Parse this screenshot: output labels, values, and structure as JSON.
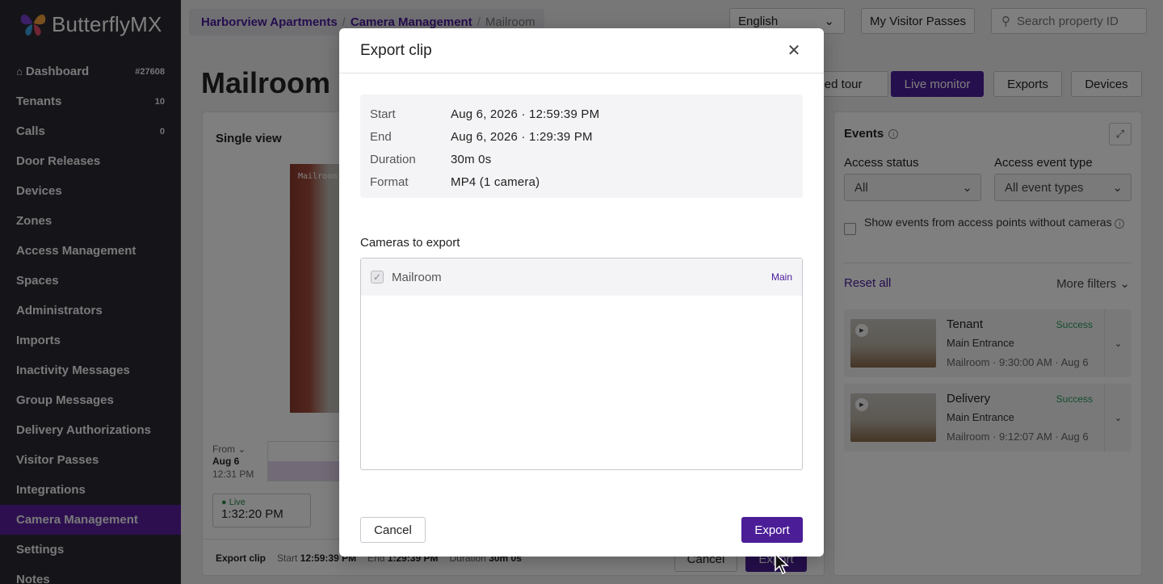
{
  "app": {
    "logo_text": "ButterflyMX"
  },
  "sidebar": {
    "items": [
      {
        "label": "Dashboard",
        "count": "#27608"
      },
      {
        "label": "Tenants",
        "count": "10"
      },
      {
        "label": "Calls",
        "count": "0"
      },
      {
        "label": "Door Releases",
        "count": ""
      },
      {
        "label": "Devices",
        "count": ""
      },
      {
        "label": "Zones",
        "count": ""
      },
      {
        "label": "Access Management",
        "count": ""
      },
      {
        "label": "Spaces",
        "count": ""
      },
      {
        "label": "Administrators",
        "count": ""
      },
      {
        "label": "Imports",
        "count": ""
      },
      {
        "label": "Inactivity Messages",
        "count": ""
      },
      {
        "label": "Group Messages",
        "count": ""
      },
      {
        "label": "Delivery Authorizations",
        "count": ""
      },
      {
        "label": "Visitor Passes",
        "count": ""
      },
      {
        "label": "Integrations",
        "count": ""
      },
      {
        "label": "Camera Management",
        "count": "",
        "active": true
      },
      {
        "label": "Settings",
        "count": ""
      },
      {
        "label": "Notes",
        "count": ""
      }
    ]
  },
  "header": {
    "breadcrumb": [
      "Harborview Apartments",
      "Camera Management",
      "Mailroom"
    ],
    "language": "English",
    "visitor_passes": "My Visitor Passes",
    "search_placeholder": "Search property ID"
  },
  "page": {
    "title": "Mailroom",
    "buttons": {
      "guided_tour": "ded tour",
      "live_monitor": "Live monitor",
      "exports": "Exports",
      "devices": "Devices"
    }
  },
  "player": {
    "view_label": "Single view",
    "camera_overlay": "Mailroom",
    "from_label": "From",
    "from_date": "Aug 6",
    "from_time": "12:31 PM",
    "live_label": "Live",
    "live_time": "1:32:20 PM",
    "footer": {
      "export_clip": "Export clip",
      "start_label": "Start",
      "start_value": "12:59:39 PM",
      "end_label": "End",
      "end_value": "1:29:39 PM",
      "duration_label": "Duration",
      "duration_value": "30m 0s",
      "cancel": "Cancel",
      "export": "Export"
    }
  },
  "events": {
    "title": "Events",
    "access_status_label": "Access status",
    "access_status_value": "All",
    "access_event_type_label": "Access event type",
    "access_event_type_value": "All event types",
    "checkbox_label": "Show events from access points without cameras",
    "reset": "Reset all",
    "more_filters": "More filters",
    "items": [
      {
        "name": "Tenant",
        "status": "Success",
        "location": "Main Entrance",
        "meta": "Mailroom · 9:30:00 AM · Aug 6"
      },
      {
        "name": "Delivery",
        "status": "Success",
        "location": "Main Entrance",
        "meta": "Mailroom · 9:12:07 AM · Aug 6"
      }
    ]
  },
  "modal": {
    "title": "Export clip",
    "summary": [
      {
        "key": "Start",
        "value": "Aug 6, 2026 · 12:59:39 PM"
      },
      {
        "key": "End",
        "value": "Aug 6, 2026 · 1:29:39 PM"
      },
      {
        "key": "Duration",
        "value": "30m 0s"
      },
      {
        "key": "Format",
        "value": "MP4 (1 camera)"
      }
    ],
    "cameras_label": "Cameras to export",
    "cameras": [
      {
        "name": "Mailroom",
        "badge": "Main",
        "checked": true
      }
    ],
    "cancel": "Cancel",
    "export": "Export"
  },
  "colors": {
    "brand": "#4b1e98",
    "sidebar_bg": "#2b2a33",
    "active_nav": "#5a1ea0",
    "success": "#2a9a5a"
  }
}
